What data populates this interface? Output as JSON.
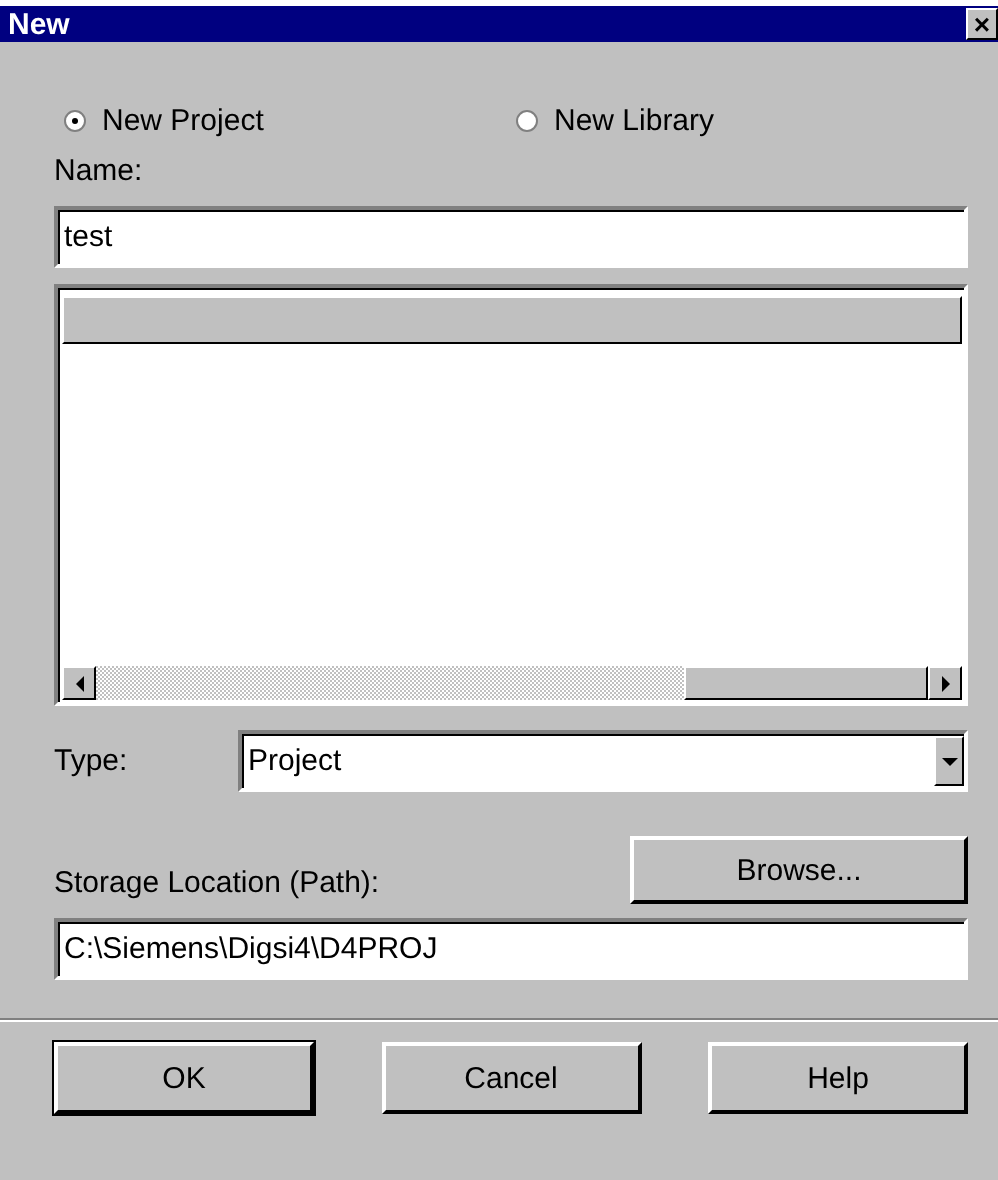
{
  "window": {
    "title": "New",
    "close": "×"
  },
  "options": [
    {
      "label": "New Project",
      "selected": true
    },
    {
      "label": "New Library",
      "selected": false
    }
  ],
  "name_field": {
    "label": "Name:",
    "value": "test"
  },
  "type_field": {
    "label": "Type:",
    "value": "Project"
  },
  "storage": {
    "label": "Storage Location (Path):",
    "browse": "Browse...",
    "value": "C:\\Siemens\\Digsi4\\D4PROJ"
  },
  "buttons": [
    {
      "label": "OK",
      "default": true
    },
    {
      "label": "Cancel",
      "default": false
    },
    {
      "label": "Help",
      "default": false
    }
  ]
}
